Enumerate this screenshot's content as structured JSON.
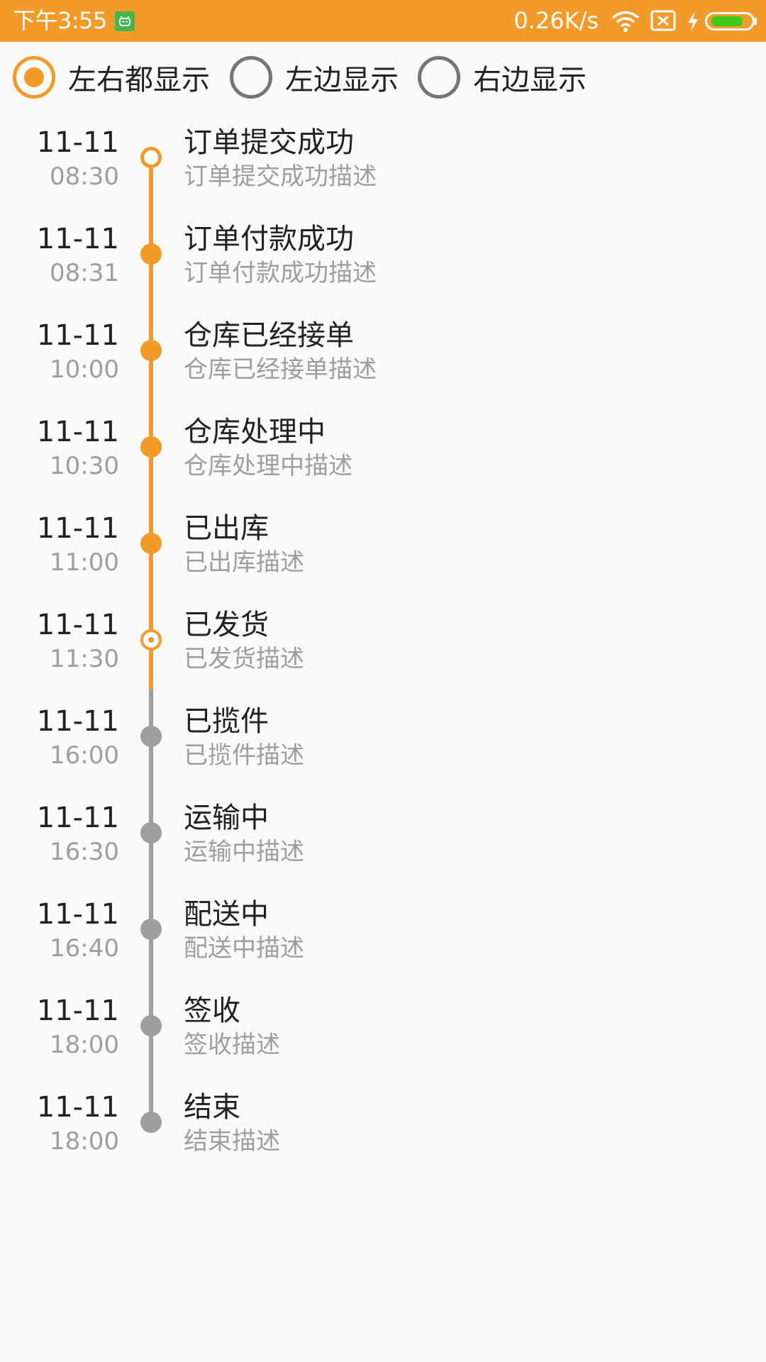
{
  "status_bar": {
    "time": "下午3:55",
    "network_speed": "0.26K/s",
    "icons": [
      "android-app-icon",
      "wifi-icon",
      "no-sim-icon",
      "charging-icon",
      "battery-icon"
    ],
    "battery_level": 0.85,
    "background_color": "#f29b2a",
    "battery_color": "#43c81c"
  },
  "radio_options": [
    {
      "label": "左右都显示",
      "checked": true
    },
    {
      "label": "左边显示",
      "checked": false
    },
    {
      "label": "右边显示",
      "checked": false
    }
  ],
  "colors": {
    "accent": "#f29b2a",
    "inactive": "#9e9e9e",
    "primary_text": "#212121",
    "secondary_text": "#9e9e9e"
  },
  "timeline": [
    {
      "date": "11-11",
      "time": "08:30",
      "title": "订单提交成功",
      "desc": "订单提交成功描述",
      "state": "start"
    },
    {
      "date": "11-11",
      "time": "08:31",
      "title": "订单付款成功",
      "desc": "订单付款成功描述",
      "state": "done"
    },
    {
      "date": "11-11",
      "time": "10:00",
      "title": "仓库已经接单",
      "desc": "仓库已经接单描述",
      "state": "done"
    },
    {
      "date": "11-11",
      "time": "10:30",
      "title": "仓库处理中",
      "desc": "仓库处理中描述",
      "state": "done"
    },
    {
      "date": "11-11",
      "time": "11:00",
      "title": "已出库",
      "desc": "已出库描述",
      "state": "done"
    },
    {
      "date": "11-11",
      "time": "11:30",
      "title": "已发货",
      "desc": "已发货描述",
      "state": "current"
    },
    {
      "date": "11-11",
      "time": "16:00",
      "title": "已揽件",
      "desc": "已揽件描述",
      "state": "pending"
    },
    {
      "date": "11-11",
      "time": "16:30",
      "title": "运输中",
      "desc": "运输中描述",
      "state": "pending"
    },
    {
      "date": "11-11",
      "time": "16:40",
      "title": "配送中",
      "desc": "配送中描述",
      "state": "pending"
    },
    {
      "date": "11-11",
      "time": "18:00",
      "title": "签收",
      "desc": "签收描述",
      "state": "pending"
    },
    {
      "date": "11-11",
      "time": "18:00",
      "title": "结束",
      "desc": "结束描述",
      "state": "pending"
    }
  ]
}
